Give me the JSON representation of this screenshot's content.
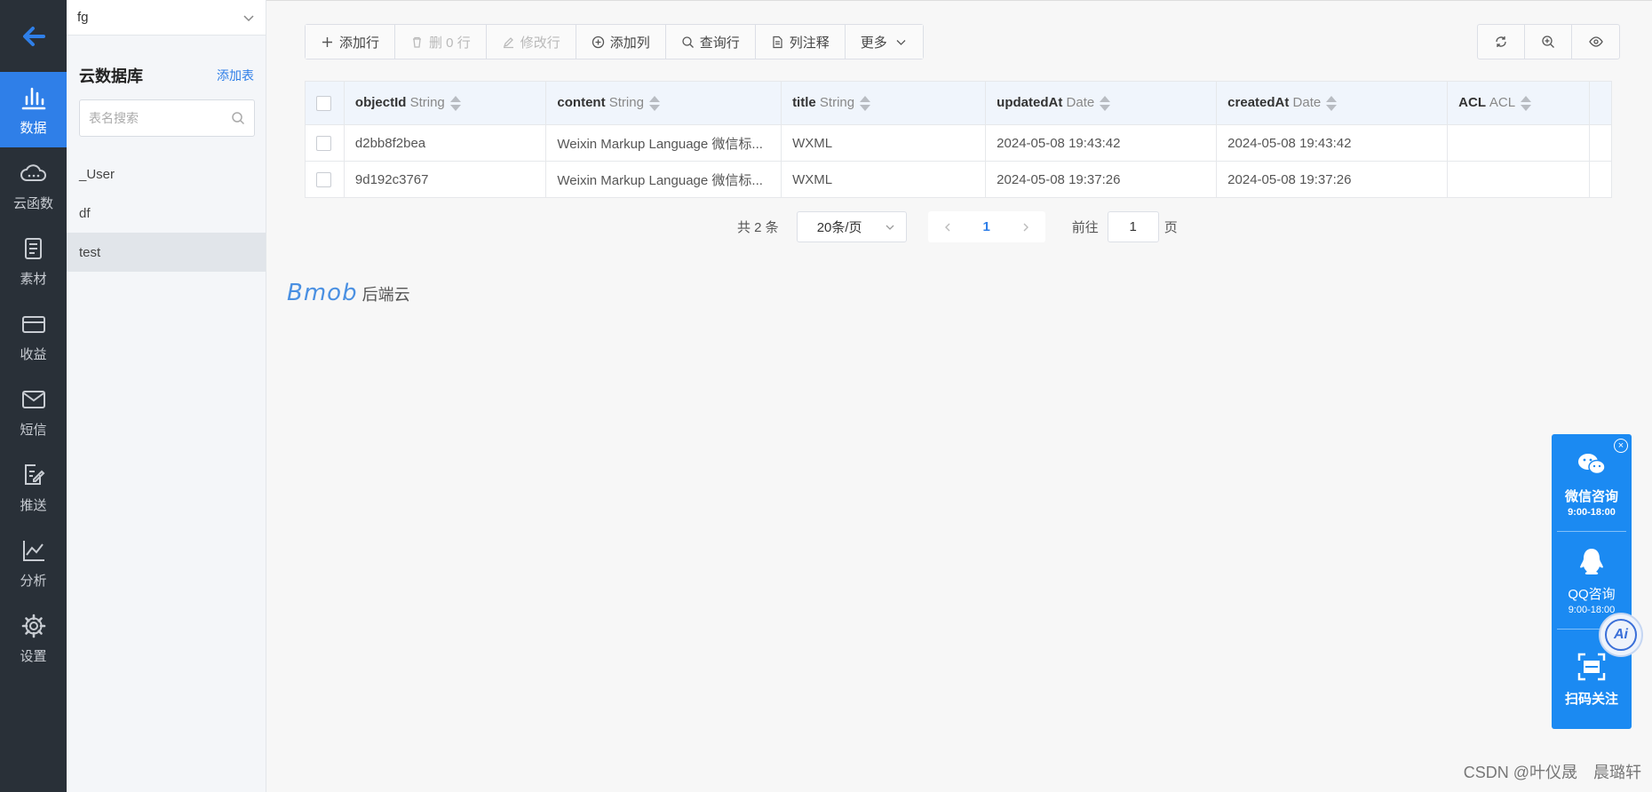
{
  "rail": {
    "back_icon": "arrow-left-icon",
    "items": [
      {
        "label": "数据",
        "icon": "bar-chart-icon",
        "active": true
      },
      {
        "label": "云函数",
        "icon": "cloud-icon"
      },
      {
        "label": "素材",
        "icon": "document-icon"
      },
      {
        "label": "收益",
        "icon": "card-icon"
      },
      {
        "label": "短信",
        "icon": "mail-icon"
      },
      {
        "label": "推送",
        "icon": "edit-doc-icon"
      },
      {
        "label": "分析",
        "icon": "line-chart-icon"
      },
      {
        "label": "设置",
        "icon": "gear-icon"
      }
    ]
  },
  "sidebar": {
    "app_name": "fg",
    "title": "云数据库",
    "add_table": "添加表",
    "search_placeholder": "表名搜索",
    "tables": [
      "_User",
      "df",
      "test"
    ],
    "selected_table": "test"
  },
  "toolbar": {
    "add_row": "添加行",
    "delete_rows": "删 0 行",
    "edit_row": "修改行",
    "add_column": "添加列",
    "query_row": "查询行",
    "column_notes": "列注释",
    "more": "更多"
  },
  "right_tools": [
    "refresh-icon",
    "zoom-in-icon",
    "eye-icon"
  ],
  "table": {
    "columns": [
      {
        "name": "objectId",
        "type": "String"
      },
      {
        "name": "content",
        "type": "String"
      },
      {
        "name": "title",
        "type": "String"
      },
      {
        "name": "updatedAt",
        "type": "Date"
      },
      {
        "name": "createdAt",
        "type": "Date"
      },
      {
        "name": "ACL",
        "type": "ACL"
      }
    ],
    "rows": [
      [
        "d2bb8f2bea",
        "Weixin Markup Language 微信标...",
        "WXML",
        "2024-05-08 19:43:42",
        "2024-05-08 19:43:42",
        ""
      ],
      [
        "9d192c3767",
        "Weixin Markup Language 微信标...",
        "WXML",
        "2024-05-08 19:37:26",
        "2024-05-08 19:37:26",
        ""
      ]
    ]
  },
  "pager": {
    "total": "共 2 条",
    "page_size": "20条/页",
    "current_page": "1",
    "goto_label": "前往",
    "goto_value": "1",
    "page_suffix": "页"
  },
  "brand": {
    "logo": "Bmob",
    "text": "后端云"
  },
  "float_panel": {
    "wechat_label": "微信咨询",
    "wechat_hours": "9:00-18:00",
    "qq_label": "QQ咨询",
    "qq_hours": "9:00-18:00",
    "scan_label": "扫码关注",
    "ai_label": "Ai"
  },
  "watermark": "CSDN @叶仪晟　晨璐轩",
  "colors": {
    "accent": "#2f7fe8",
    "rail_bg": "#293038",
    "float_bg": "#1b8af2"
  }
}
